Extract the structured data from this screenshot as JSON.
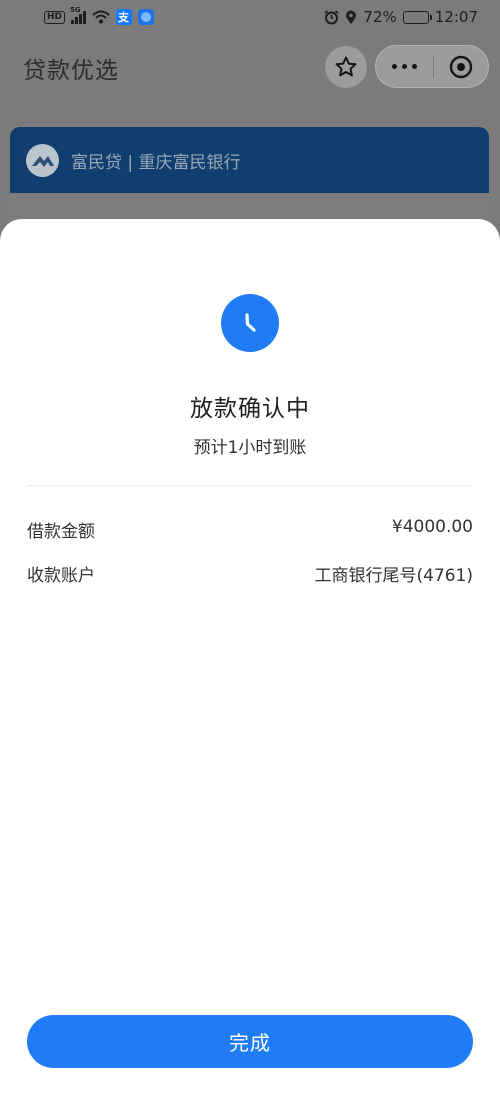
{
  "status_bar": {
    "hd": "HD",
    "network": "5G",
    "battery_percent": "72%",
    "battery_level": 0.72,
    "time": "12:07",
    "icons": [
      "hd-icon",
      "signal-icon",
      "wifi-icon",
      "alipay-icon",
      "app-icon",
      "alarm-icon",
      "location-icon",
      "battery-icon"
    ]
  },
  "header": {
    "title": "贷款优选",
    "favorite_icon": "star-icon",
    "more_icon": "more-dots-icon",
    "close_icon": "target-icon"
  },
  "loan_card": {
    "name": "富民贷 | 重庆富民银行",
    "logo_icon": "bank-logo-icon"
  },
  "sheet": {
    "status_icon": "clock-icon",
    "status_title": "放款确认中",
    "status_subtitle": "预计1小时到账",
    "details": [
      {
        "label": "借款金额",
        "value": "¥4000.00"
      },
      {
        "label": "收款账户",
        "value": "工商银行尾号(4761)"
      }
    ],
    "done_label": "完成"
  },
  "colors": {
    "accent": "#1f7cf6",
    "card": "#0f3e6f",
    "overlay": "#7b7b7b"
  }
}
